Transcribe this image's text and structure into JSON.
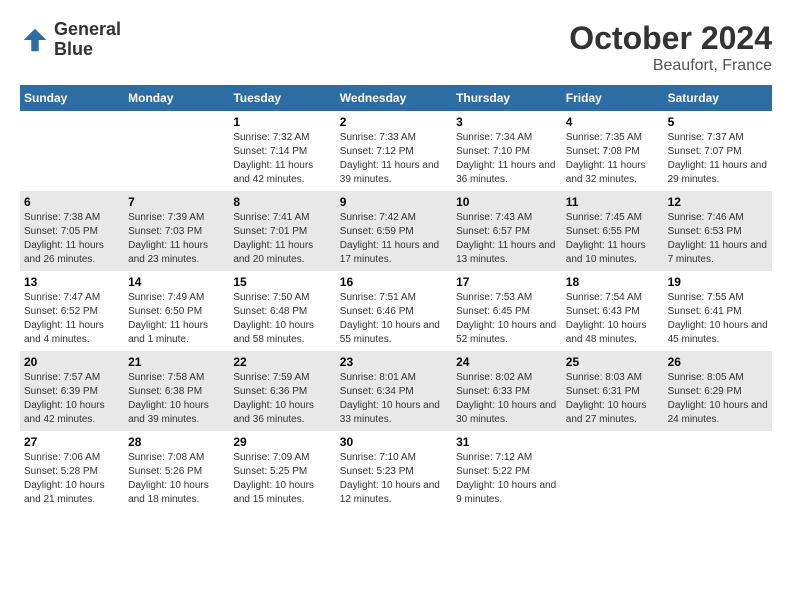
{
  "logo": {
    "line1": "General",
    "line2": "Blue"
  },
  "title": "October 2024",
  "subtitle": "Beaufort, France",
  "days_of_week": [
    "Sunday",
    "Monday",
    "Tuesday",
    "Wednesday",
    "Thursday",
    "Friday",
    "Saturday"
  ],
  "weeks": [
    [
      {
        "day": "",
        "sunrise": "",
        "sunset": "",
        "daylight": ""
      },
      {
        "day": "",
        "sunrise": "",
        "sunset": "",
        "daylight": ""
      },
      {
        "day": "1",
        "sunrise": "Sunrise: 7:32 AM",
        "sunset": "Sunset: 7:14 PM",
        "daylight": "Daylight: 11 hours and 42 minutes."
      },
      {
        "day": "2",
        "sunrise": "Sunrise: 7:33 AM",
        "sunset": "Sunset: 7:12 PM",
        "daylight": "Daylight: 11 hours and 39 minutes."
      },
      {
        "day": "3",
        "sunrise": "Sunrise: 7:34 AM",
        "sunset": "Sunset: 7:10 PM",
        "daylight": "Daylight: 11 hours and 36 minutes."
      },
      {
        "day": "4",
        "sunrise": "Sunrise: 7:35 AM",
        "sunset": "Sunset: 7:08 PM",
        "daylight": "Daylight: 11 hours and 32 minutes."
      },
      {
        "day": "5",
        "sunrise": "Sunrise: 7:37 AM",
        "sunset": "Sunset: 7:07 PM",
        "daylight": "Daylight: 11 hours and 29 minutes."
      }
    ],
    [
      {
        "day": "6",
        "sunrise": "Sunrise: 7:38 AM",
        "sunset": "Sunset: 7:05 PM",
        "daylight": "Daylight: 11 hours and 26 minutes."
      },
      {
        "day": "7",
        "sunrise": "Sunrise: 7:39 AM",
        "sunset": "Sunset: 7:03 PM",
        "daylight": "Daylight: 11 hours and 23 minutes."
      },
      {
        "day": "8",
        "sunrise": "Sunrise: 7:41 AM",
        "sunset": "Sunset: 7:01 PM",
        "daylight": "Daylight: 11 hours and 20 minutes."
      },
      {
        "day": "9",
        "sunrise": "Sunrise: 7:42 AM",
        "sunset": "Sunset: 6:59 PM",
        "daylight": "Daylight: 11 hours and 17 minutes."
      },
      {
        "day": "10",
        "sunrise": "Sunrise: 7:43 AM",
        "sunset": "Sunset: 6:57 PM",
        "daylight": "Daylight: 11 hours and 13 minutes."
      },
      {
        "day": "11",
        "sunrise": "Sunrise: 7:45 AM",
        "sunset": "Sunset: 6:55 PM",
        "daylight": "Daylight: 11 hours and 10 minutes."
      },
      {
        "day": "12",
        "sunrise": "Sunrise: 7:46 AM",
        "sunset": "Sunset: 6:53 PM",
        "daylight": "Daylight: 11 hours and 7 minutes."
      }
    ],
    [
      {
        "day": "13",
        "sunrise": "Sunrise: 7:47 AM",
        "sunset": "Sunset: 6:52 PM",
        "daylight": "Daylight: 11 hours and 4 minutes."
      },
      {
        "day": "14",
        "sunrise": "Sunrise: 7:49 AM",
        "sunset": "Sunset: 6:50 PM",
        "daylight": "Daylight: 11 hours and 1 minute."
      },
      {
        "day": "15",
        "sunrise": "Sunrise: 7:50 AM",
        "sunset": "Sunset: 6:48 PM",
        "daylight": "Daylight: 10 hours and 58 minutes."
      },
      {
        "day": "16",
        "sunrise": "Sunrise: 7:51 AM",
        "sunset": "Sunset: 6:46 PM",
        "daylight": "Daylight: 10 hours and 55 minutes."
      },
      {
        "day": "17",
        "sunrise": "Sunrise: 7:53 AM",
        "sunset": "Sunset: 6:45 PM",
        "daylight": "Daylight: 10 hours and 52 minutes."
      },
      {
        "day": "18",
        "sunrise": "Sunrise: 7:54 AM",
        "sunset": "Sunset: 6:43 PM",
        "daylight": "Daylight: 10 hours and 48 minutes."
      },
      {
        "day": "19",
        "sunrise": "Sunrise: 7:55 AM",
        "sunset": "Sunset: 6:41 PM",
        "daylight": "Daylight: 10 hours and 45 minutes."
      }
    ],
    [
      {
        "day": "20",
        "sunrise": "Sunrise: 7:57 AM",
        "sunset": "Sunset: 6:39 PM",
        "daylight": "Daylight: 10 hours and 42 minutes."
      },
      {
        "day": "21",
        "sunrise": "Sunrise: 7:58 AM",
        "sunset": "Sunset: 6:38 PM",
        "daylight": "Daylight: 10 hours and 39 minutes."
      },
      {
        "day": "22",
        "sunrise": "Sunrise: 7:59 AM",
        "sunset": "Sunset: 6:36 PM",
        "daylight": "Daylight: 10 hours and 36 minutes."
      },
      {
        "day": "23",
        "sunrise": "Sunrise: 8:01 AM",
        "sunset": "Sunset: 6:34 PM",
        "daylight": "Daylight: 10 hours and 33 minutes."
      },
      {
        "day": "24",
        "sunrise": "Sunrise: 8:02 AM",
        "sunset": "Sunset: 6:33 PM",
        "daylight": "Daylight: 10 hours and 30 minutes."
      },
      {
        "day": "25",
        "sunrise": "Sunrise: 8:03 AM",
        "sunset": "Sunset: 6:31 PM",
        "daylight": "Daylight: 10 hours and 27 minutes."
      },
      {
        "day": "26",
        "sunrise": "Sunrise: 8:05 AM",
        "sunset": "Sunset: 6:29 PM",
        "daylight": "Daylight: 10 hours and 24 minutes."
      }
    ],
    [
      {
        "day": "27",
        "sunrise": "Sunrise: 7:06 AM",
        "sunset": "Sunset: 5:28 PM",
        "daylight": "Daylight: 10 hours and 21 minutes."
      },
      {
        "day": "28",
        "sunrise": "Sunrise: 7:08 AM",
        "sunset": "Sunset: 5:26 PM",
        "daylight": "Daylight: 10 hours and 18 minutes."
      },
      {
        "day": "29",
        "sunrise": "Sunrise: 7:09 AM",
        "sunset": "Sunset: 5:25 PM",
        "daylight": "Daylight: 10 hours and 15 minutes."
      },
      {
        "day": "30",
        "sunrise": "Sunrise: 7:10 AM",
        "sunset": "Sunset: 5:23 PM",
        "daylight": "Daylight: 10 hours and 12 minutes."
      },
      {
        "day": "31",
        "sunrise": "Sunrise: 7:12 AM",
        "sunset": "Sunset: 5:22 PM",
        "daylight": "Daylight: 10 hours and 9 minutes."
      },
      {
        "day": "",
        "sunrise": "",
        "sunset": "",
        "daylight": ""
      },
      {
        "day": "",
        "sunrise": "",
        "sunset": "",
        "daylight": ""
      }
    ]
  ]
}
